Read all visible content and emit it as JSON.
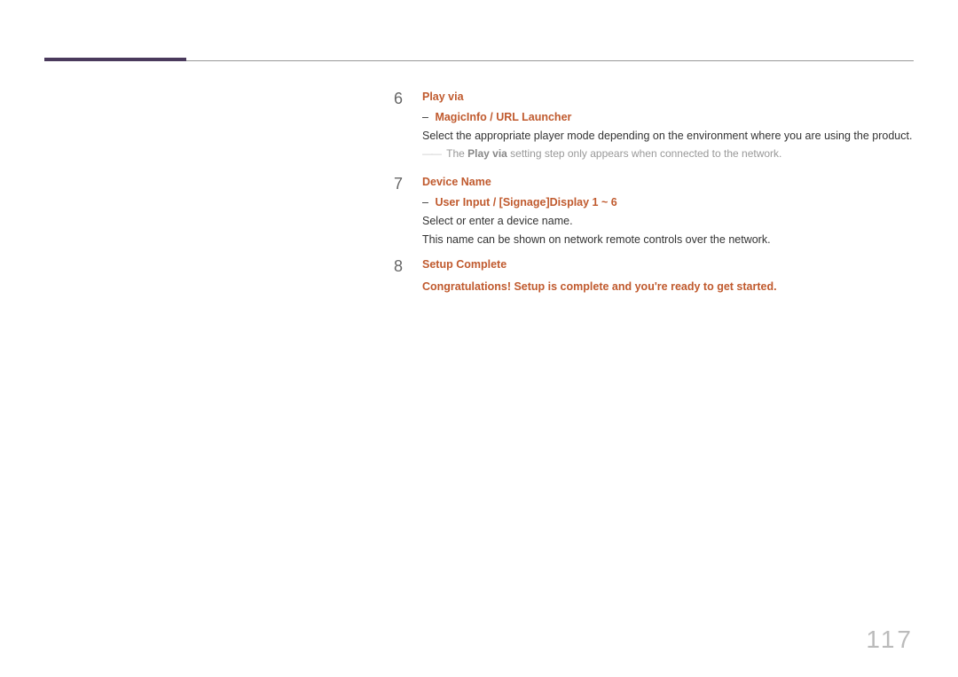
{
  "steps": [
    {
      "number": "6",
      "heading": "Play via",
      "sub_highlight": "MagicInfo / URL Launcher",
      "body1": "Select the appropriate player mode depending on the environment where you are using the product.",
      "note_pre": "The ",
      "note_bold": "Play via",
      "note_post": " setting step only appears when connected to the network."
    },
    {
      "number": "7",
      "heading": "Device Name",
      "sub_highlight": "User Input / [Signage]Display 1 ~ 6",
      "body1": "Select or enter a device name.",
      "body2": "This name can be shown on network remote controls over the network."
    },
    {
      "number": "8",
      "heading": "Setup Complete",
      "highlight_body": "Congratulations! Setup is complete and you're ready to get started."
    }
  ],
  "page_number": "117"
}
